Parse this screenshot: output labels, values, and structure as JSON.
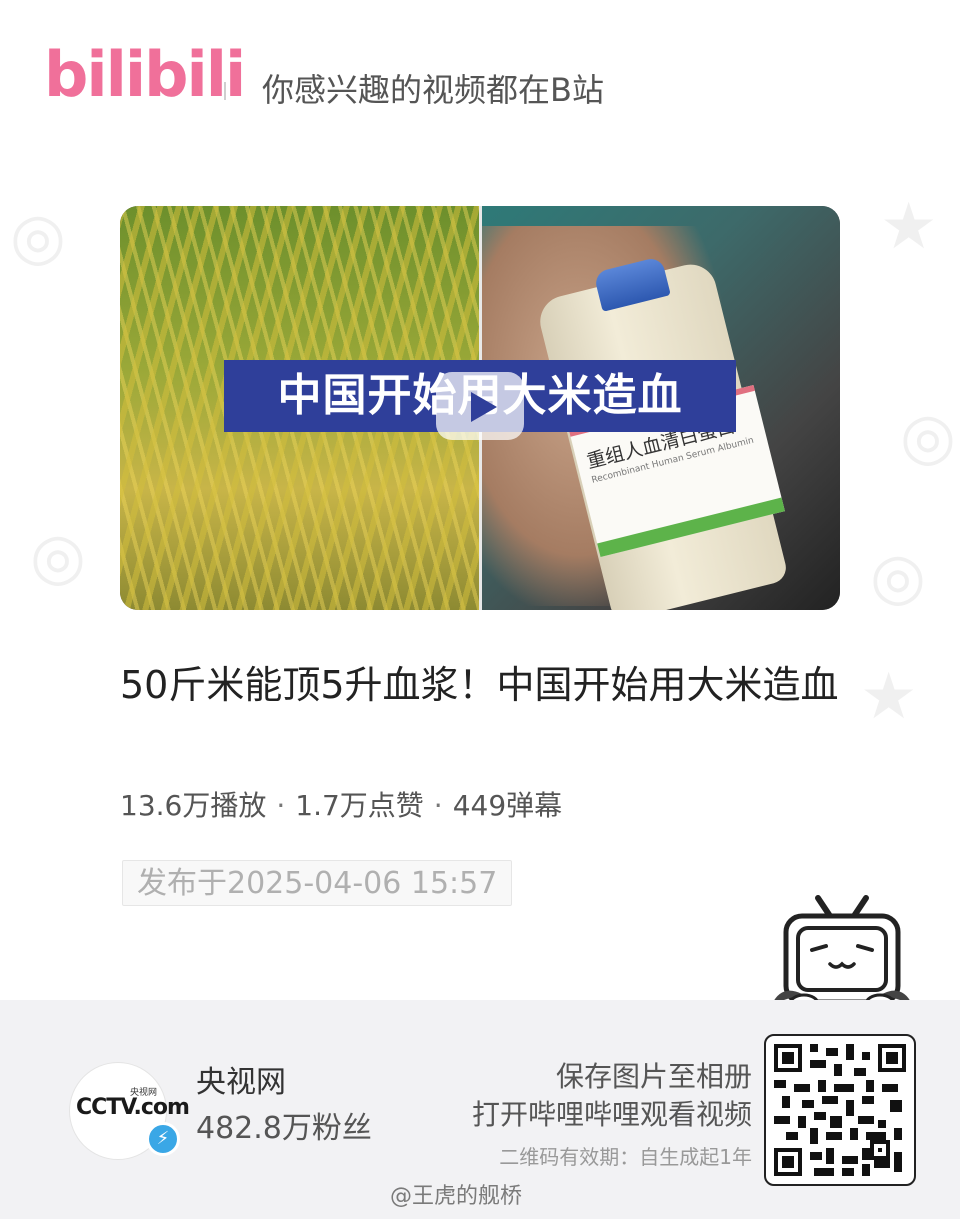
{
  "header": {
    "logo_text": "bilibili",
    "slogan": "你感兴趣的视频都在B站"
  },
  "video": {
    "cover_banner": "中国开始用大米造血",
    "cover_vial_label": "重组人血清白蛋白",
    "cover_vial_label_small": "Recombinant Human Serum Albumin",
    "title": "50斤米能顶5升血浆！中国开始用大米造血",
    "stats": {
      "plays": "13.6万播放",
      "likes": "1.7万点赞",
      "danmaku": "449弹幕",
      "separator": "·"
    },
    "publish_date": "发布于2025-04-06 15:57"
  },
  "uploader": {
    "avatar_logo": "CCTV.com",
    "avatar_logo_small": "央视网",
    "name": "央视网",
    "fans": "482.8万粉丝",
    "badge_icon": "lightning-icon"
  },
  "share": {
    "save_tip": "保存图片至相册",
    "open_tip": "打开哔哩哔哩观看视频",
    "expire_tip": "二维码有效期：自生成起1年"
  },
  "watermark": "@王虎的舰桥",
  "colors": {
    "brand_pink": "#f0709a",
    "banner_blue": "#2f3f9a",
    "verify_blue": "#3aa7e6"
  }
}
